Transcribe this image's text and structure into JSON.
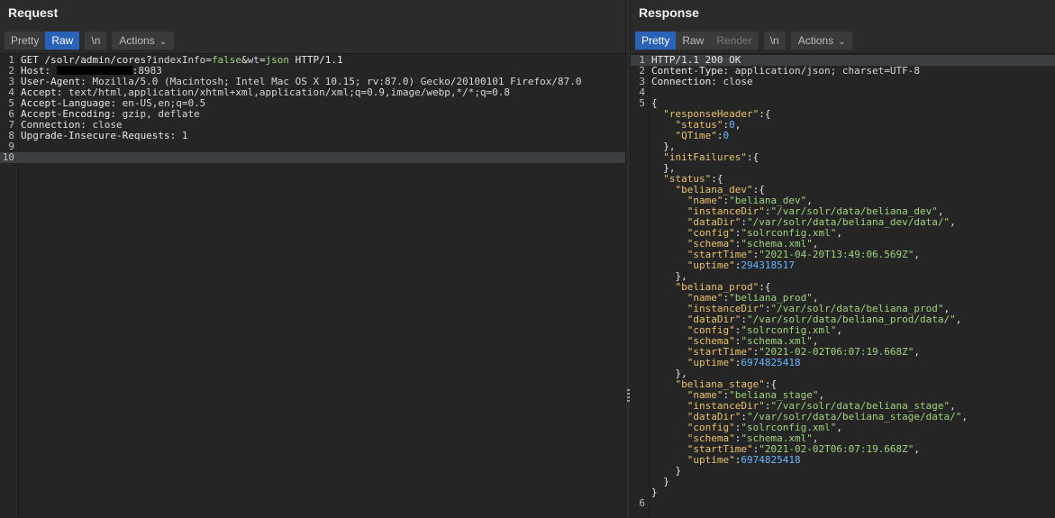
{
  "request": {
    "title": "Request",
    "tabs": [
      {
        "label": "Pretty",
        "active": false
      },
      {
        "label": "Raw",
        "active": true
      }
    ],
    "newline_label": "\\n",
    "actions_label": "Actions",
    "lines": [
      {
        "n": "1",
        "parts": [
          [
            "k",
            "GET /solr/admin/cores?"
          ],
          [
            "v",
            "indexInfo"
          ],
          [
            "k",
            "="
          ],
          [
            "qv",
            "false"
          ],
          [
            "k",
            "&"
          ],
          [
            "v",
            "wt"
          ],
          [
            "k",
            "="
          ],
          [
            "qv",
            "json"
          ],
          [
            "k",
            " HTTP/1.1"
          ]
        ]
      },
      {
        "n": "2",
        "parts": [
          [
            "k",
            "Host: "
          ],
          [
            "redact",
            ""
          ],
          [
            "v",
            ":8983"
          ]
        ]
      },
      {
        "n": "3",
        "parts": [
          [
            "k",
            "User-Agent: "
          ],
          [
            "v",
            "Mozilla/5.0 (Macintosh; Intel Mac OS X 10.15; rv:87.0) Gecko/20100101 Firefox/87.0"
          ]
        ]
      },
      {
        "n": "4",
        "parts": [
          [
            "k",
            "Accept: "
          ],
          [
            "v",
            "text/html,application/xhtml+xml,application/xml;q=0.9,image/webp,*/*;q=0.8"
          ]
        ]
      },
      {
        "n": "5",
        "parts": [
          [
            "k",
            "Accept-Language: "
          ],
          [
            "v",
            "en-US,en;q=0.5"
          ]
        ]
      },
      {
        "n": "6",
        "parts": [
          [
            "k",
            "Accept-Encoding: "
          ],
          [
            "v",
            "gzip, deflate"
          ]
        ]
      },
      {
        "n": "7",
        "parts": [
          [
            "k",
            "Connection: "
          ],
          [
            "v",
            "close"
          ]
        ]
      },
      {
        "n": "8",
        "parts": [
          [
            "k",
            "Upgrade-Insecure-Requests: "
          ],
          [
            "v",
            "1"
          ]
        ]
      },
      {
        "n": "9",
        "parts": []
      },
      {
        "n": "10",
        "parts": [],
        "highlight": true
      }
    ]
  },
  "response": {
    "title": "Response",
    "tabs": [
      {
        "label": "Pretty",
        "active": true
      },
      {
        "label": "Raw",
        "active": false
      },
      {
        "label": "Render",
        "active": false,
        "disabled": true
      }
    ],
    "newline_label": "\\n",
    "actions_label": "Actions",
    "lines": [
      {
        "n": "1",
        "parts": [
          [
            "k",
            "HTTP/1.1 200 OK"
          ]
        ],
        "highlight": true
      },
      {
        "n": "2",
        "parts": [
          [
            "k",
            "Content-Type: "
          ],
          [
            "v",
            "application/json; charset=UTF-8"
          ]
        ]
      },
      {
        "n": "3",
        "parts": [
          [
            "k",
            "Connection: "
          ],
          [
            "v",
            "close"
          ]
        ]
      },
      {
        "n": "4",
        "parts": []
      },
      {
        "n": "5",
        "parts": [
          [
            "jp",
            "{"
          ]
        ]
      },
      {
        "n": "",
        "parts": [
          [
            "jp",
            "  "
          ],
          [
            "jk",
            "\"responseHeader\""
          ],
          [
            "jp",
            ":{"
          ]
        ]
      },
      {
        "n": "",
        "parts": [
          [
            "jp",
            "    "
          ],
          [
            "jk",
            "\"status\""
          ],
          [
            "jp",
            ":"
          ],
          [
            "jn",
            "0"
          ],
          [
            "jp",
            ","
          ]
        ]
      },
      {
        "n": "",
        "parts": [
          [
            "jp",
            "    "
          ],
          [
            "jk",
            "\"QTime\""
          ],
          [
            "jp",
            ":"
          ],
          [
            "jn",
            "0"
          ]
        ]
      },
      {
        "n": "",
        "parts": [
          [
            "jp",
            "  },"
          ]
        ]
      },
      {
        "n": "",
        "parts": [
          [
            "jp",
            "  "
          ],
          [
            "jk",
            "\"initFailures\""
          ],
          [
            "jp",
            ":{"
          ]
        ]
      },
      {
        "n": "",
        "parts": [
          [
            "jp",
            "  },"
          ]
        ]
      },
      {
        "n": "",
        "parts": [
          [
            "jp",
            "  "
          ],
          [
            "jk",
            "\"status\""
          ],
          [
            "jp",
            ":{"
          ]
        ]
      },
      {
        "n": "",
        "parts": [
          [
            "jp",
            "    "
          ],
          [
            "jk",
            "\"beliana_dev\""
          ],
          [
            "jp",
            ":{"
          ]
        ]
      },
      {
        "n": "",
        "parts": [
          [
            "jp",
            "      "
          ],
          [
            "jk",
            "\"name\""
          ],
          [
            "jp",
            ":"
          ],
          [
            "js",
            "\"beliana_dev\""
          ],
          [
            "jp",
            ","
          ]
        ]
      },
      {
        "n": "",
        "parts": [
          [
            "jp",
            "      "
          ],
          [
            "jk",
            "\"instanceDir\""
          ],
          [
            "jp",
            ":"
          ],
          [
            "js",
            "\"/var/solr/data/beliana_dev\""
          ],
          [
            "jp",
            ","
          ]
        ]
      },
      {
        "n": "",
        "parts": [
          [
            "jp",
            "      "
          ],
          [
            "jk",
            "\"dataDir\""
          ],
          [
            "jp",
            ":"
          ],
          [
            "js",
            "\"/var/solr/data/beliana_dev/data/\""
          ],
          [
            "jp",
            ","
          ]
        ]
      },
      {
        "n": "",
        "parts": [
          [
            "jp",
            "      "
          ],
          [
            "jk",
            "\"config\""
          ],
          [
            "jp",
            ":"
          ],
          [
            "js",
            "\"solrconfig.xml\""
          ],
          [
            "jp",
            ","
          ]
        ]
      },
      {
        "n": "",
        "parts": [
          [
            "jp",
            "      "
          ],
          [
            "jk",
            "\"schema\""
          ],
          [
            "jp",
            ":"
          ],
          [
            "js",
            "\"schema.xml\""
          ],
          [
            "jp",
            ","
          ]
        ]
      },
      {
        "n": "",
        "parts": [
          [
            "jp",
            "      "
          ],
          [
            "jk",
            "\"startTime\""
          ],
          [
            "jp",
            ":"
          ],
          [
            "js",
            "\"2021-04-20T13:49:06.569Z\""
          ],
          [
            "jp",
            ","
          ]
        ]
      },
      {
        "n": "",
        "parts": [
          [
            "jp",
            "      "
          ],
          [
            "jk",
            "\"uptime\""
          ],
          [
            "jp",
            ":"
          ],
          [
            "jn",
            "294318517"
          ]
        ]
      },
      {
        "n": "",
        "parts": [
          [
            "jp",
            "    },"
          ]
        ]
      },
      {
        "n": "",
        "parts": [
          [
            "jp",
            "    "
          ],
          [
            "jk",
            "\"beliana_prod\""
          ],
          [
            "jp",
            ":{"
          ]
        ]
      },
      {
        "n": "",
        "parts": [
          [
            "jp",
            "      "
          ],
          [
            "jk",
            "\"name\""
          ],
          [
            "jp",
            ":"
          ],
          [
            "js",
            "\"beliana_prod\""
          ],
          [
            "jp",
            ","
          ]
        ]
      },
      {
        "n": "",
        "parts": [
          [
            "jp",
            "      "
          ],
          [
            "jk",
            "\"instanceDir\""
          ],
          [
            "jp",
            ":"
          ],
          [
            "js",
            "\"/var/solr/data/beliana_prod\""
          ],
          [
            "jp",
            ","
          ]
        ]
      },
      {
        "n": "",
        "parts": [
          [
            "jp",
            "      "
          ],
          [
            "jk",
            "\"dataDir\""
          ],
          [
            "jp",
            ":"
          ],
          [
            "js",
            "\"/var/solr/data/beliana_prod/data/\""
          ],
          [
            "jp",
            ","
          ]
        ]
      },
      {
        "n": "",
        "parts": [
          [
            "jp",
            "      "
          ],
          [
            "jk",
            "\"config\""
          ],
          [
            "jp",
            ":"
          ],
          [
            "js",
            "\"solrconfig.xml\""
          ],
          [
            "jp",
            ","
          ]
        ]
      },
      {
        "n": "",
        "parts": [
          [
            "jp",
            "      "
          ],
          [
            "jk",
            "\"schema\""
          ],
          [
            "jp",
            ":"
          ],
          [
            "js",
            "\"schema.xml\""
          ],
          [
            "jp",
            ","
          ]
        ]
      },
      {
        "n": "",
        "parts": [
          [
            "jp",
            "      "
          ],
          [
            "jk",
            "\"startTime\""
          ],
          [
            "jp",
            ":"
          ],
          [
            "js",
            "\"2021-02-02T06:07:19.668Z\""
          ],
          [
            "jp",
            ","
          ]
        ]
      },
      {
        "n": "",
        "parts": [
          [
            "jp",
            "      "
          ],
          [
            "jk",
            "\"uptime\""
          ],
          [
            "jp",
            ":"
          ],
          [
            "jn",
            "6974825418"
          ]
        ]
      },
      {
        "n": "",
        "parts": [
          [
            "jp",
            "    },"
          ]
        ]
      },
      {
        "n": "",
        "parts": [
          [
            "jp",
            "    "
          ],
          [
            "jk",
            "\"beliana_stage\""
          ],
          [
            "jp",
            ":{"
          ]
        ]
      },
      {
        "n": "",
        "parts": [
          [
            "jp",
            "      "
          ],
          [
            "jk",
            "\"name\""
          ],
          [
            "jp",
            ":"
          ],
          [
            "js",
            "\"beliana_stage\""
          ],
          [
            "jp",
            ","
          ]
        ]
      },
      {
        "n": "",
        "parts": [
          [
            "jp",
            "      "
          ],
          [
            "jk",
            "\"instanceDir\""
          ],
          [
            "jp",
            ":"
          ],
          [
            "js",
            "\"/var/solr/data/beliana_stage\""
          ],
          [
            "jp",
            ","
          ]
        ]
      },
      {
        "n": "",
        "parts": [
          [
            "jp",
            "      "
          ],
          [
            "jk",
            "\"dataDir\""
          ],
          [
            "jp",
            ":"
          ],
          [
            "js",
            "\"/var/solr/data/beliana_stage/data/\""
          ],
          [
            "jp",
            ","
          ]
        ]
      },
      {
        "n": "",
        "parts": [
          [
            "jp",
            "      "
          ],
          [
            "jk",
            "\"config\""
          ],
          [
            "jp",
            ":"
          ],
          [
            "js",
            "\"solrconfig.xml\""
          ],
          [
            "jp",
            ","
          ]
        ]
      },
      {
        "n": "",
        "parts": [
          [
            "jp",
            "      "
          ],
          [
            "jk",
            "\"schema\""
          ],
          [
            "jp",
            ":"
          ],
          [
            "js",
            "\"schema.xml\""
          ],
          [
            "jp",
            ","
          ]
        ]
      },
      {
        "n": "",
        "parts": [
          [
            "jp",
            "      "
          ],
          [
            "jk",
            "\"startTime\""
          ],
          [
            "jp",
            ":"
          ],
          [
            "js",
            "\"2021-02-02T06:07:19.668Z\""
          ],
          [
            "jp",
            ","
          ]
        ]
      },
      {
        "n": "",
        "parts": [
          [
            "jp",
            "      "
          ],
          [
            "jk",
            "\"uptime\""
          ],
          [
            "jp",
            ":"
          ],
          [
            "jn",
            "6974825418"
          ]
        ]
      },
      {
        "n": "",
        "parts": [
          [
            "jp",
            "    }"
          ]
        ]
      },
      {
        "n": "",
        "parts": [
          [
            "jp",
            "  }"
          ]
        ]
      },
      {
        "n": "",
        "parts": [
          [
            "jp",
            "}"
          ]
        ]
      },
      {
        "n": "6",
        "parts": []
      }
    ]
  }
}
